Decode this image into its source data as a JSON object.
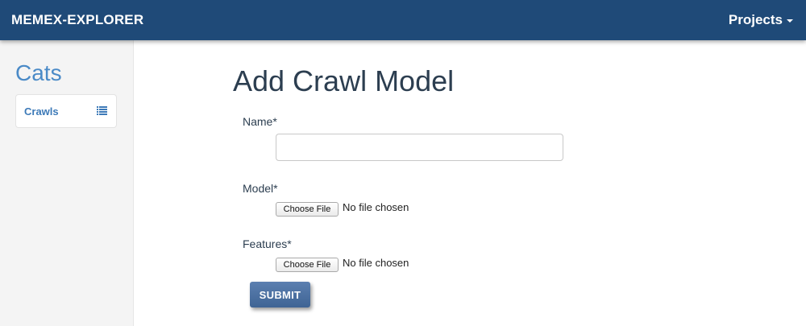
{
  "navbar": {
    "brand": "MEMEX-EXPLORER",
    "projects_label": "Projects",
    "bg_color": "#1f4a78"
  },
  "sidebar": {
    "project_title": "Cats",
    "items": [
      {
        "label": "Crawls",
        "icon": "list-icon"
      }
    ]
  },
  "main": {
    "title": "Add Crawl Model",
    "form": {
      "name": {
        "label": "Name*",
        "value": "",
        "placeholder": ""
      },
      "model": {
        "label": "Model*",
        "button_label": "Choose File",
        "status": "No file chosen"
      },
      "features": {
        "label": "Features*",
        "button_label": "Choose File",
        "status": "No file chosen"
      },
      "submit_label": "SUBMIT"
    }
  }
}
